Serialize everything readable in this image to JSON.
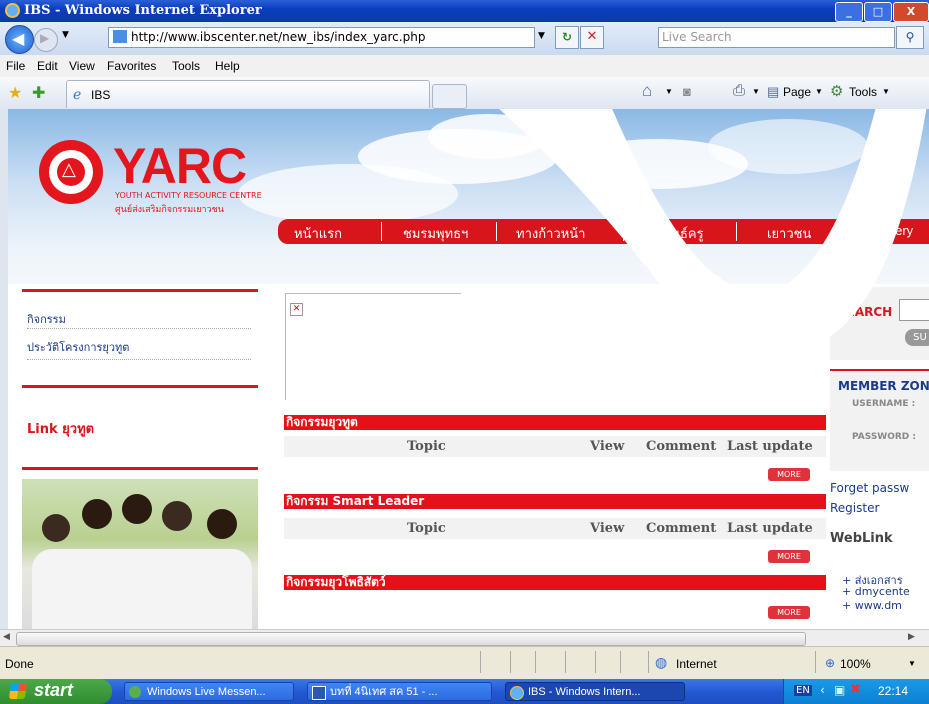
{
  "window": {
    "title": "IBS - Windows Internet Explorer",
    "min": "_",
    "max": "□",
    "close": "X"
  },
  "address": {
    "url": "http://www.ibscenter.net/new_ibs/index_yarc.php",
    "search_placeholder": "Live Search"
  },
  "menu": [
    "File",
    "Edit",
    "View",
    "Favorites",
    "Tools",
    "Help"
  ],
  "favbar": {
    "tab_title": "IBS",
    "page_label": "Page",
    "tools_label": "Tools"
  },
  "site": {
    "logo_text": "YARC",
    "logo_sub1": "YOUTH ACTIVITY RESOURCE CENTRE",
    "logo_sub2": "ศูนย์ส่งเสริมกิจกรรมเยาวชน",
    "nav": [
      "หน้าแรก",
      "ชมรมพุทธฯ",
      "ทางก้าวหน้า",
      "สหพันธ์ครู",
      "เยาวชน",
      "Gallery"
    ],
    "left_links": [
      "กิจกรรม",
      "ประวัติโครงการยุวทูต"
    ],
    "link_title": "Link ยุวทูต",
    "sections": [
      {
        "title": "กิจกรรมยุวทูต",
        "cols": [
          "Topic",
          "View",
          "Comment",
          "Last update"
        ],
        "more": "MORE"
      },
      {
        "title": "กิจกรรม Smart Leader",
        "cols": [
          "Topic",
          "View",
          "Comment",
          "Last update"
        ],
        "more": "MORE"
      },
      {
        "title": "กิจกรรมยุวโพธิสัตว์",
        "more": "MORE"
      }
    ],
    "right": {
      "search_label": "SEARCH",
      "search_btn": "SU",
      "member_title": "MEMBER ZON",
      "username": "USERNAME :",
      "password": "PASSWORD :",
      "forget": "Forget passw",
      "register": "Register",
      "weblink_title": "WebLink",
      "weblinks": [
        "+ ส่งเอกสาร",
        "+ dmycente",
        "+ www.dm"
      ]
    }
  },
  "status": {
    "done": "Done",
    "zone": "Internet",
    "zoom": "100%"
  },
  "taskbar": {
    "start": "start",
    "tasks": [
      "Windows Live Messen...",
      "บทที่ 4นิเทศ สค 51 - ...",
      "IBS - Windows Intern..."
    ],
    "lang": "EN",
    "clock": "22:14"
  },
  "colors": {
    "brand_red": "#d8151b",
    "xp_blue": "#2459d4"
  }
}
